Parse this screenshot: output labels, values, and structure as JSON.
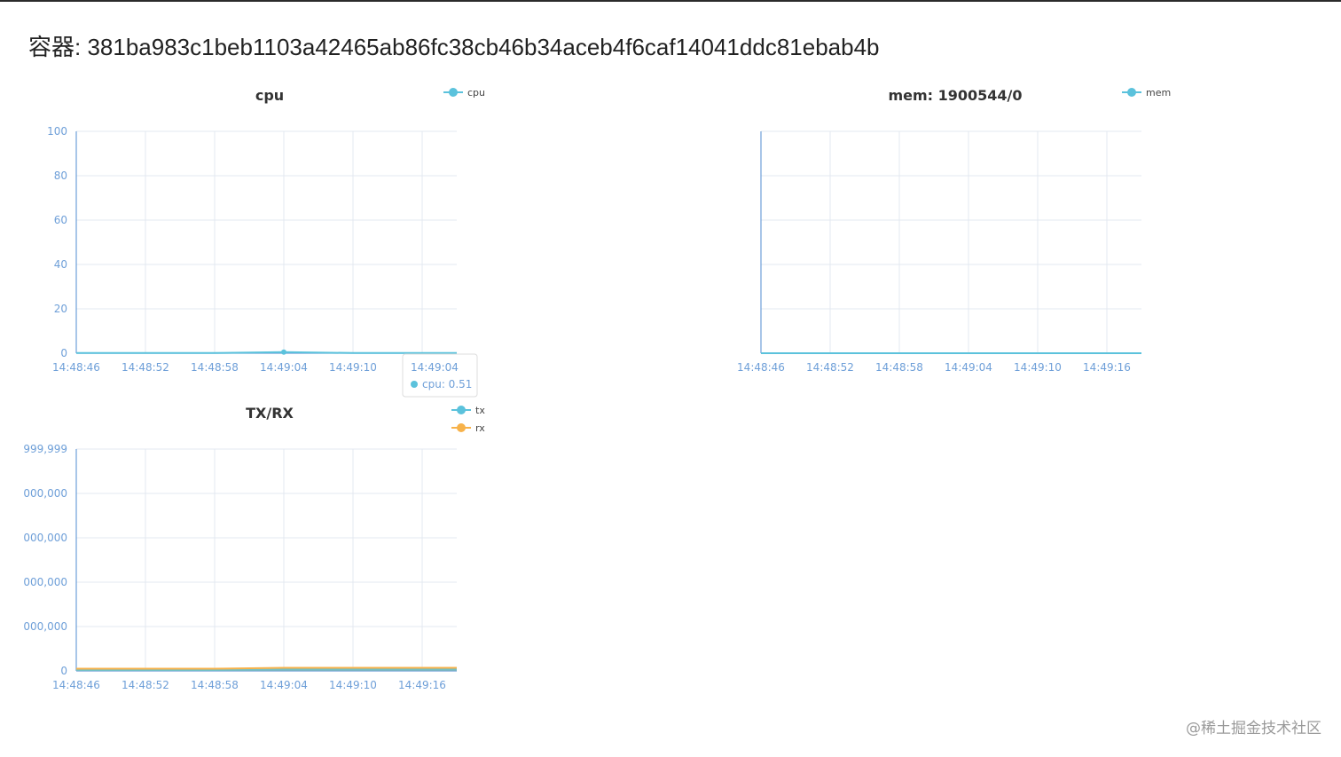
{
  "page": {
    "title_prefix": "容器: ",
    "container_id": "381ba983c1beb1103a42465ab86fc38cb46b34aceb4f6caf14041ddc81ebab4b",
    "watermark": "@稀土掘金技术社区"
  },
  "colors": {
    "cpu": "#5bc2dc",
    "mem": "#5bc2dc",
    "tx": "#5bc2dc",
    "rx": "#f7b24a",
    "axis": "#6e9fd8",
    "grid": "#e3e8f0",
    "tick_text": "#6e9fd8",
    "title_text": "#333333"
  },
  "chart_data": [
    {
      "id": "cpu",
      "type": "line",
      "title": "cpu",
      "legend": [
        "cpu"
      ],
      "legend_position": "top-right",
      "categories": [
        "14:48:46",
        "14:48:52",
        "14:48:58",
        "14:49:04",
        "14:49:10",
        "14:49:16"
      ],
      "x_tick_labels": [
        "14:48:46",
        "14:48:52",
        "14:48:58",
        "14:49:04",
        "14:49:10"
      ],
      "y_ticks": [
        "0",
        "20",
        "40",
        "60",
        "80",
        "100"
      ],
      "ylim": [
        0,
        100
      ],
      "grid": true,
      "series": [
        {
          "name": "cpu",
          "values": [
            0.1,
            0.1,
            0.1,
            0.51,
            0.1,
            0.1
          ]
        }
      ],
      "tooltip": {
        "x": "14:49:04",
        "series": "cpu",
        "label": "cpu: 0.51"
      }
    },
    {
      "id": "mem",
      "type": "line",
      "title": "mem: 1900544/0",
      "legend": [
        "mem"
      ],
      "legend_position": "top-right",
      "categories": [
        "14:48:46",
        "14:48:52",
        "14:48:58",
        "14:49:04",
        "14:49:10",
        "14:49:16"
      ],
      "x_tick_labels": [
        "14:48:46",
        "14:48:52",
        "14:48:58",
        "14:49:04",
        "14:49:10",
        "14:49:16"
      ],
      "y_ticks": [],
      "ylim": [
        0,
        1
      ],
      "grid": true,
      "series": [
        {
          "name": "mem",
          "values": [
            0,
            0,
            0,
            0,
            0,
            0
          ]
        }
      ]
    },
    {
      "id": "txrx",
      "type": "line",
      "title": "TX/RX",
      "legend": [
        "tx",
        "rx"
      ],
      "legend_position": "top-right",
      "categories": [
        "14:48:46",
        "14:48:52",
        "14:48:58",
        "14:49:04",
        "14:49:10",
        "14:49:16"
      ],
      "x_tick_labels": [
        "14:48:46",
        "14:48:52",
        "14:48:58",
        "14:49:04",
        "14:49:10",
        "14:49:16"
      ],
      "y_ticks": [
        "0",
        "000,000",
        "000,000",
        "000,000",
        "000,000",
        "999,999"
      ],
      "ylim": [
        0,
        5
      ],
      "grid": true,
      "series": [
        {
          "name": "tx",
          "values": [
            0.02,
            0.02,
            0.02,
            0.03,
            0.03,
            0.03
          ]
        },
        {
          "name": "rx",
          "values": [
            0.05,
            0.05,
            0.05,
            0.07,
            0.07,
            0.07
          ]
        }
      ]
    }
  ]
}
